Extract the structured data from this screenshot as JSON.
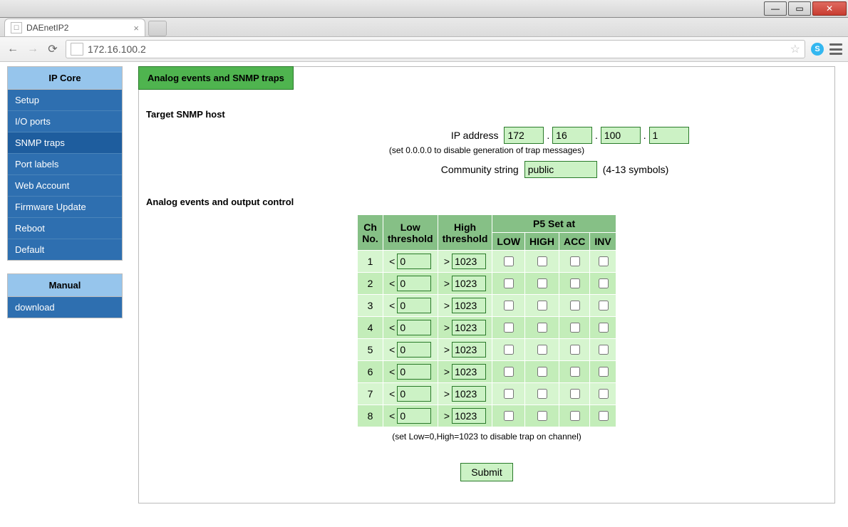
{
  "window": {
    "tab_title": "DAEnetIP2",
    "url": "172.16.100.2"
  },
  "sidebar": {
    "groups": [
      {
        "title": "IP Core",
        "items": [
          "Setup",
          "I/O ports",
          "SNMP traps",
          "Port labels",
          "Web Account",
          "Firmware Update",
          "Reboot",
          "Default"
        ],
        "selected": 2
      },
      {
        "title": "Manual",
        "items": [
          "download"
        ],
        "selected": -1
      }
    ]
  },
  "page": {
    "badge": "Analog events and SNMP traps",
    "section_target": "Target SNMP host",
    "ip_label": "IP address",
    "ip_octets": [
      "172",
      "16",
      "100",
      "1"
    ],
    "ip_hint": "(set 0.0.0.0 to disable generation of trap messages)",
    "community_label": "Community string",
    "community_value": "public",
    "community_hint": "(4-13 symbols)",
    "section_analog": "Analog events and output control",
    "table": {
      "head": {
        "ch_no_line1": "Ch",
        "ch_no_line2": "No.",
        "low_line1": "Low",
        "low_line2": "threshold",
        "high_line1": "High",
        "high_line2": "threshold",
        "p5": "P5 Set at",
        "sub": [
          "LOW",
          "HIGH",
          "ACC",
          "INV"
        ]
      },
      "rows": [
        {
          "no": "1",
          "low": "0",
          "high": "1023"
        },
        {
          "no": "2",
          "low": "0",
          "high": "1023"
        },
        {
          "no": "3",
          "low": "0",
          "high": "1023"
        },
        {
          "no": "4",
          "low": "0",
          "high": "1023"
        },
        {
          "no": "5",
          "low": "0",
          "high": "1023"
        },
        {
          "no": "6",
          "low": "0",
          "high": "1023"
        },
        {
          "no": "7",
          "low": "0",
          "high": "1023"
        },
        {
          "no": "8",
          "low": "0",
          "high": "1023"
        }
      ],
      "foot_hint": "(set Low=0,High=1023 to disable trap on channel)"
    },
    "submit": "Submit"
  }
}
